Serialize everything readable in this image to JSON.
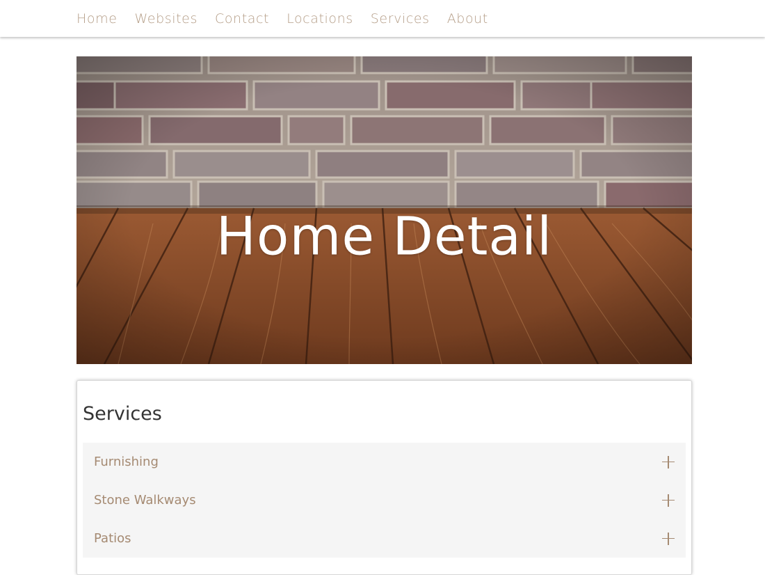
{
  "nav": {
    "items": [
      {
        "label": "Home"
      },
      {
        "label": "Websites"
      },
      {
        "label": "Contact"
      },
      {
        "label": "Locations"
      },
      {
        "label": "Services"
      },
      {
        "label": "About"
      }
    ]
  },
  "hero": {
    "title": "Home Detail",
    "image": "brick-wall-wood-floor-photo"
  },
  "services": {
    "heading": "Services",
    "items": [
      {
        "label": "Furnishing",
        "icon": "plus-icon"
      },
      {
        "label": "Stone Walkways",
        "icon": "plus-icon"
      },
      {
        "label": "Patios",
        "icon": "plus-icon"
      }
    ]
  },
  "colors": {
    "nav_text": "#b59e88",
    "accordion_text": "#a58a72",
    "accordion_bg": "#f5f5f5"
  }
}
